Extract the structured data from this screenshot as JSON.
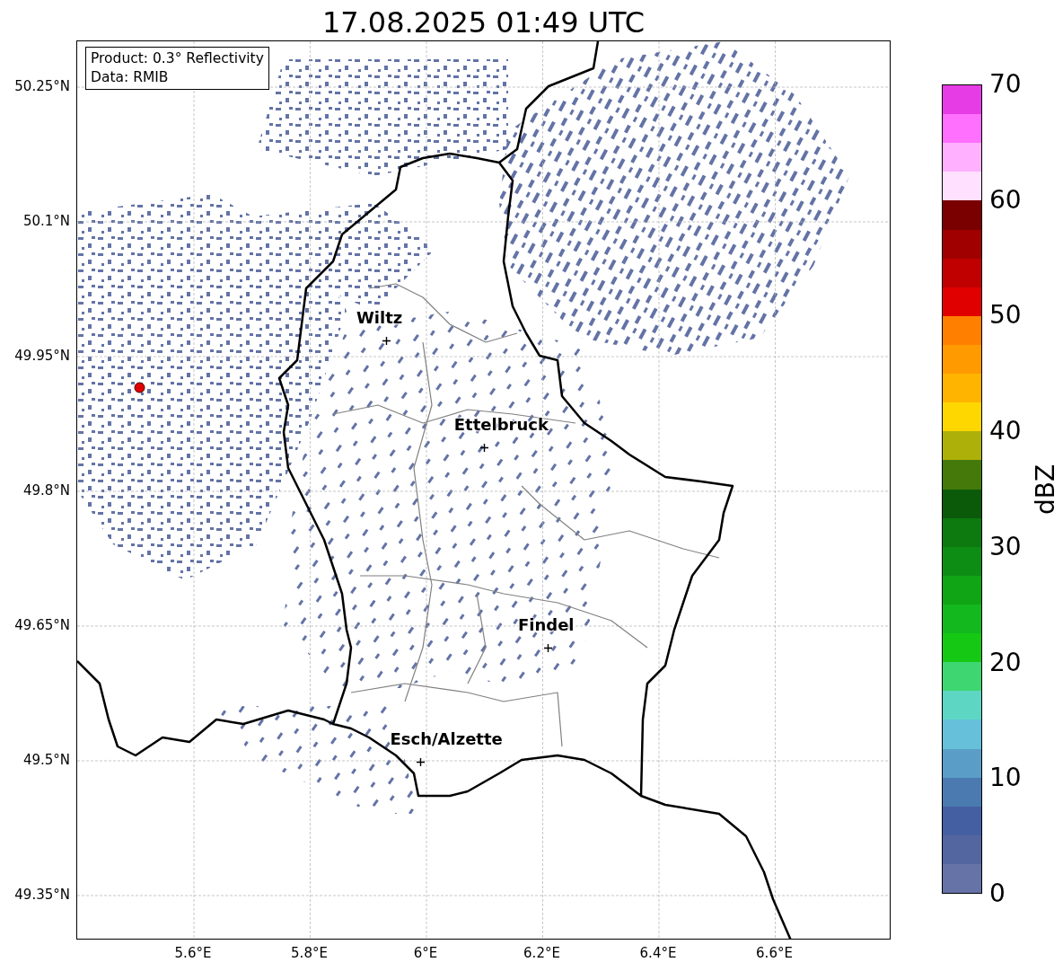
{
  "title": "17.08.2025 01:49 UTC",
  "info_box": [
    "Product: 0.3° Reflectivity",
    "Data: RMIB"
  ],
  "map": {
    "cities": [
      {
        "name": "Wiltz"
      },
      {
        "name": "Ettelbruck"
      },
      {
        "name": "Findel"
      },
      {
        "name": "Esch/Alzette"
      }
    ],
    "y_ticks": [
      "50.25°N",
      "50.1°N",
      "49.95°N",
      "49.8°N",
      "49.65°N",
      "49.5°N",
      "49.35°N"
    ],
    "x_ticks": [
      "5.6°E",
      "5.8°E",
      "6°E",
      "6.2°E",
      "6.4°E",
      "6.6°E"
    ]
  },
  "colorbar": {
    "label": "dBZ",
    "ticks": [
      "70",
      "60",
      "50",
      "40",
      "30",
      "20",
      "10",
      "0"
    ],
    "bins": [
      {
        "color": "#e63ce6"
      },
      {
        "color": "#ff70ff"
      },
      {
        "color": "#ffb0ff"
      },
      {
        "color": "#ffe0ff"
      },
      {
        "color": "#7a0000"
      },
      {
        "color": "#a00000"
      },
      {
        "color": "#c00000"
      },
      {
        "color": "#e00000"
      },
      {
        "color": "#ff8000"
      },
      {
        "color": "#ff9a00"
      },
      {
        "color": "#ffb400"
      },
      {
        "color": "#ffd700"
      },
      {
        "color": "#aeb00a"
      },
      {
        "color": "#457a0a"
      },
      {
        "color": "#0a5a0a"
      },
      {
        "color": "#0c7a0e"
      },
      {
        "color": "#0e8d14"
      },
      {
        "color": "#10a514"
      },
      {
        "color": "#12b81e"
      },
      {
        "color": "#14c814"
      },
      {
        "color": "#3dd670"
      },
      {
        "color": "#5ed6c4"
      },
      {
        "color": "#66c0da"
      },
      {
        "color": "#5a9dc6"
      },
      {
        "color": "#4a7ab0"
      },
      {
        "color": "#4460a3"
      },
      {
        "color": "#5466a0"
      },
      {
        "color": "#6673a6"
      }
    ]
  }
}
